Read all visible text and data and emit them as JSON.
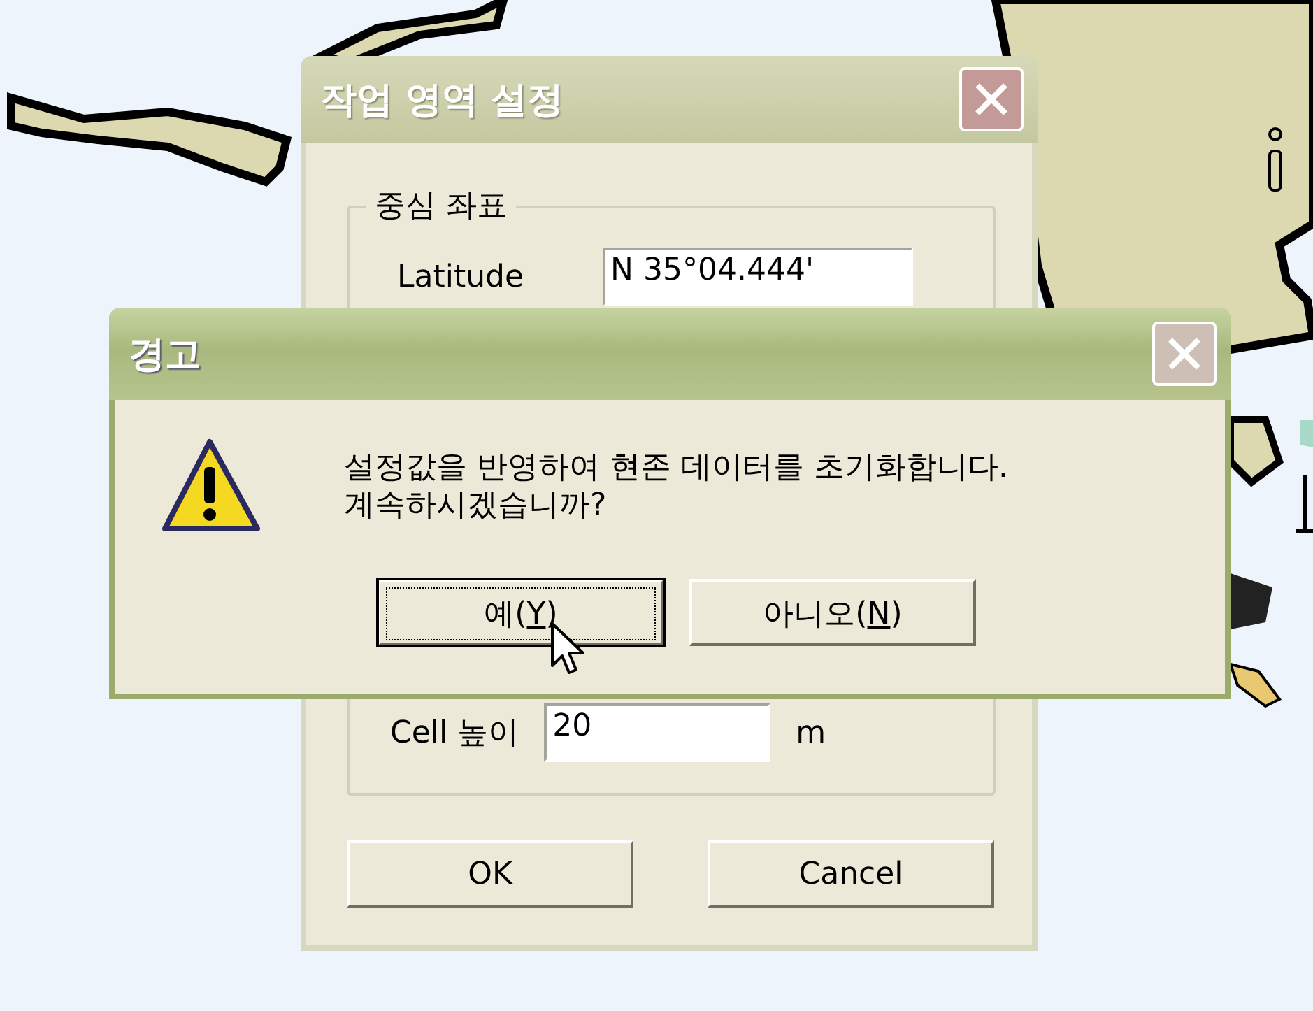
{
  "settings_dialog": {
    "title": "작업 영역 설정",
    "active": false,
    "group": {
      "title": "중심 좌표"
    },
    "latitude": {
      "label": "Latitude",
      "value": "N 35°04.444'"
    },
    "cell_height": {
      "label": "Cell 높이",
      "value": "20",
      "unit": "m"
    },
    "buttons": [
      "OK",
      "Cancel"
    ]
  },
  "alert_dialog": {
    "title": "경고",
    "active": true,
    "message": [
      "설정값을 반영하여 현존 데이터를 초기화합니다.",
      "계속하시겠습니까?"
    ],
    "buttons": [
      {
        "before": "예(",
        "mnemonic": "Y",
        "after": ")",
        "focused": true
      },
      {
        "before": "아니오(",
        "mnemonic": "N",
        "after": ")",
        "focused": false
      }
    ]
  }
}
